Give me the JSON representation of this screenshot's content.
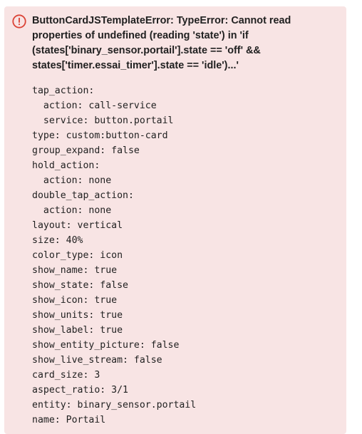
{
  "error": {
    "title": "ButtonCardJSTemplateError: TypeError: Cannot read properties of undefined (reading 'state') in 'if (states['binary_sensor.portail'].state == 'off' && states['timer.essai_timer'].state == 'idle')...'",
    "icon": "alert-circle-icon",
    "colors": {
      "background": "#f8e4e4",
      "icon": "#db4437",
      "text": "#212121"
    }
  },
  "config_lines": [
    "tap_action:",
    "  action: call-service",
    "  service: button.portail",
    "type: custom:button-card",
    "group_expand: false",
    "hold_action:",
    "  action: none",
    "double_tap_action:",
    "  action: none",
    "layout: vertical",
    "size: 40%",
    "color_type: icon",
    "show_name: true",
    "show_state: false",
    "show_icon: true",
    "show_units: true",
    "show_label: true",
    "show_entity_picture: false",
    "show_live_stream: false",
    "card_size: 3",
    "aspect_ratio: 3/1",
    "entity: binary_sensor.portail",
    "name: Portail"
  ]
}
